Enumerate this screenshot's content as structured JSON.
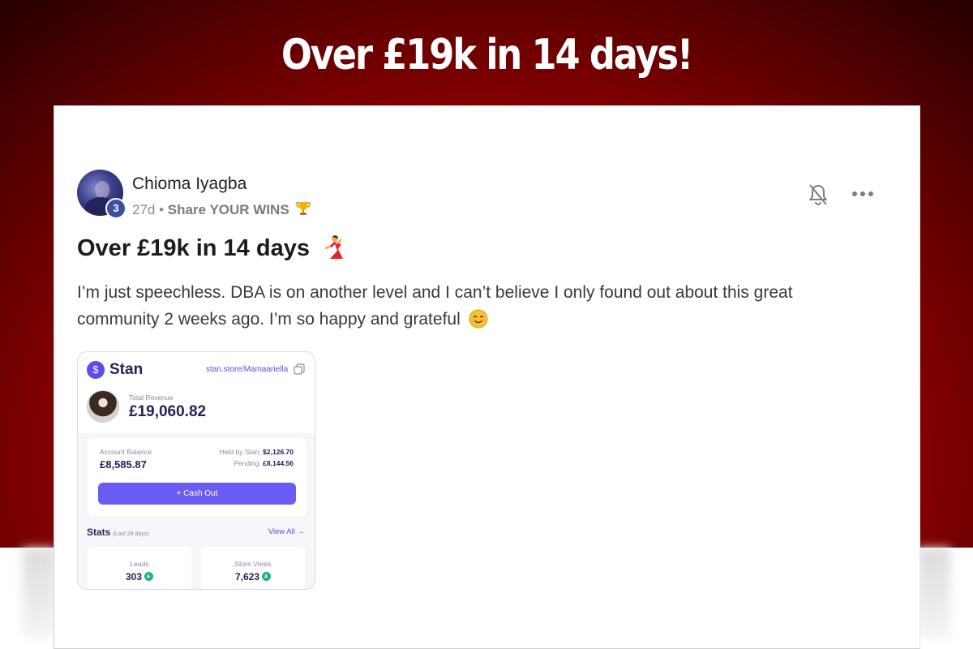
{
  "banner": {
    "headline": "Over £19k in 14 days!"
  },
  "post": {
    "author": "Chioma Iyagba",
    "level": "3",
    "age": "27d",
    "separator": " • ",
    "category": "Share YOUR WINS",
    "title": "Over £19k in 14 days",
    "body": "I’m just speechless. DBA is on another level and I can’t believe I only found out about this great community 2 weeks ago. I’m so happy and grateful"
  },
  "icons": {
    "trophy": "trophy-icon",
    "dancer": "dancing-woman-emoji",
    "smile": "smiling-face-emoji",
    "bell": "bell-off-icon",
    "more": "more-horizontal-icon"
  },
  "stan": {
    "logo_symbol": "$",
    "brand": "Stan",
    "store_url": "stan.store/Mamaariella",
    "revenue_label": "Total Revenue",
    "revenue_value": "£19,060.82",
    "balance_label": "Account Balance",
    "balance_value": "£8,585.87",
    "held_label": "Held by Stan:",
    "held_value": "$2,126.70",
    "pending_label": "Pending:",
    "pending_value": "£8,144.56",
    "cashout_label": "+ Cash Out",
    "stats_title": "Stats",
    "stats_period": "(Last 28 days)",
    "view_all": "View All →",
    "leads_label": "Leads",
    "leads_value": "303",
    "views_label": "Store Views",
    "views_value": "7,623"
  },
  "colors": {
    "banner_red": "#c00000",
    "stan_purple": "#6a5cf2",
    "stan_navy": "#23235a",
    "up_green": "#19b67a"
  }
}
